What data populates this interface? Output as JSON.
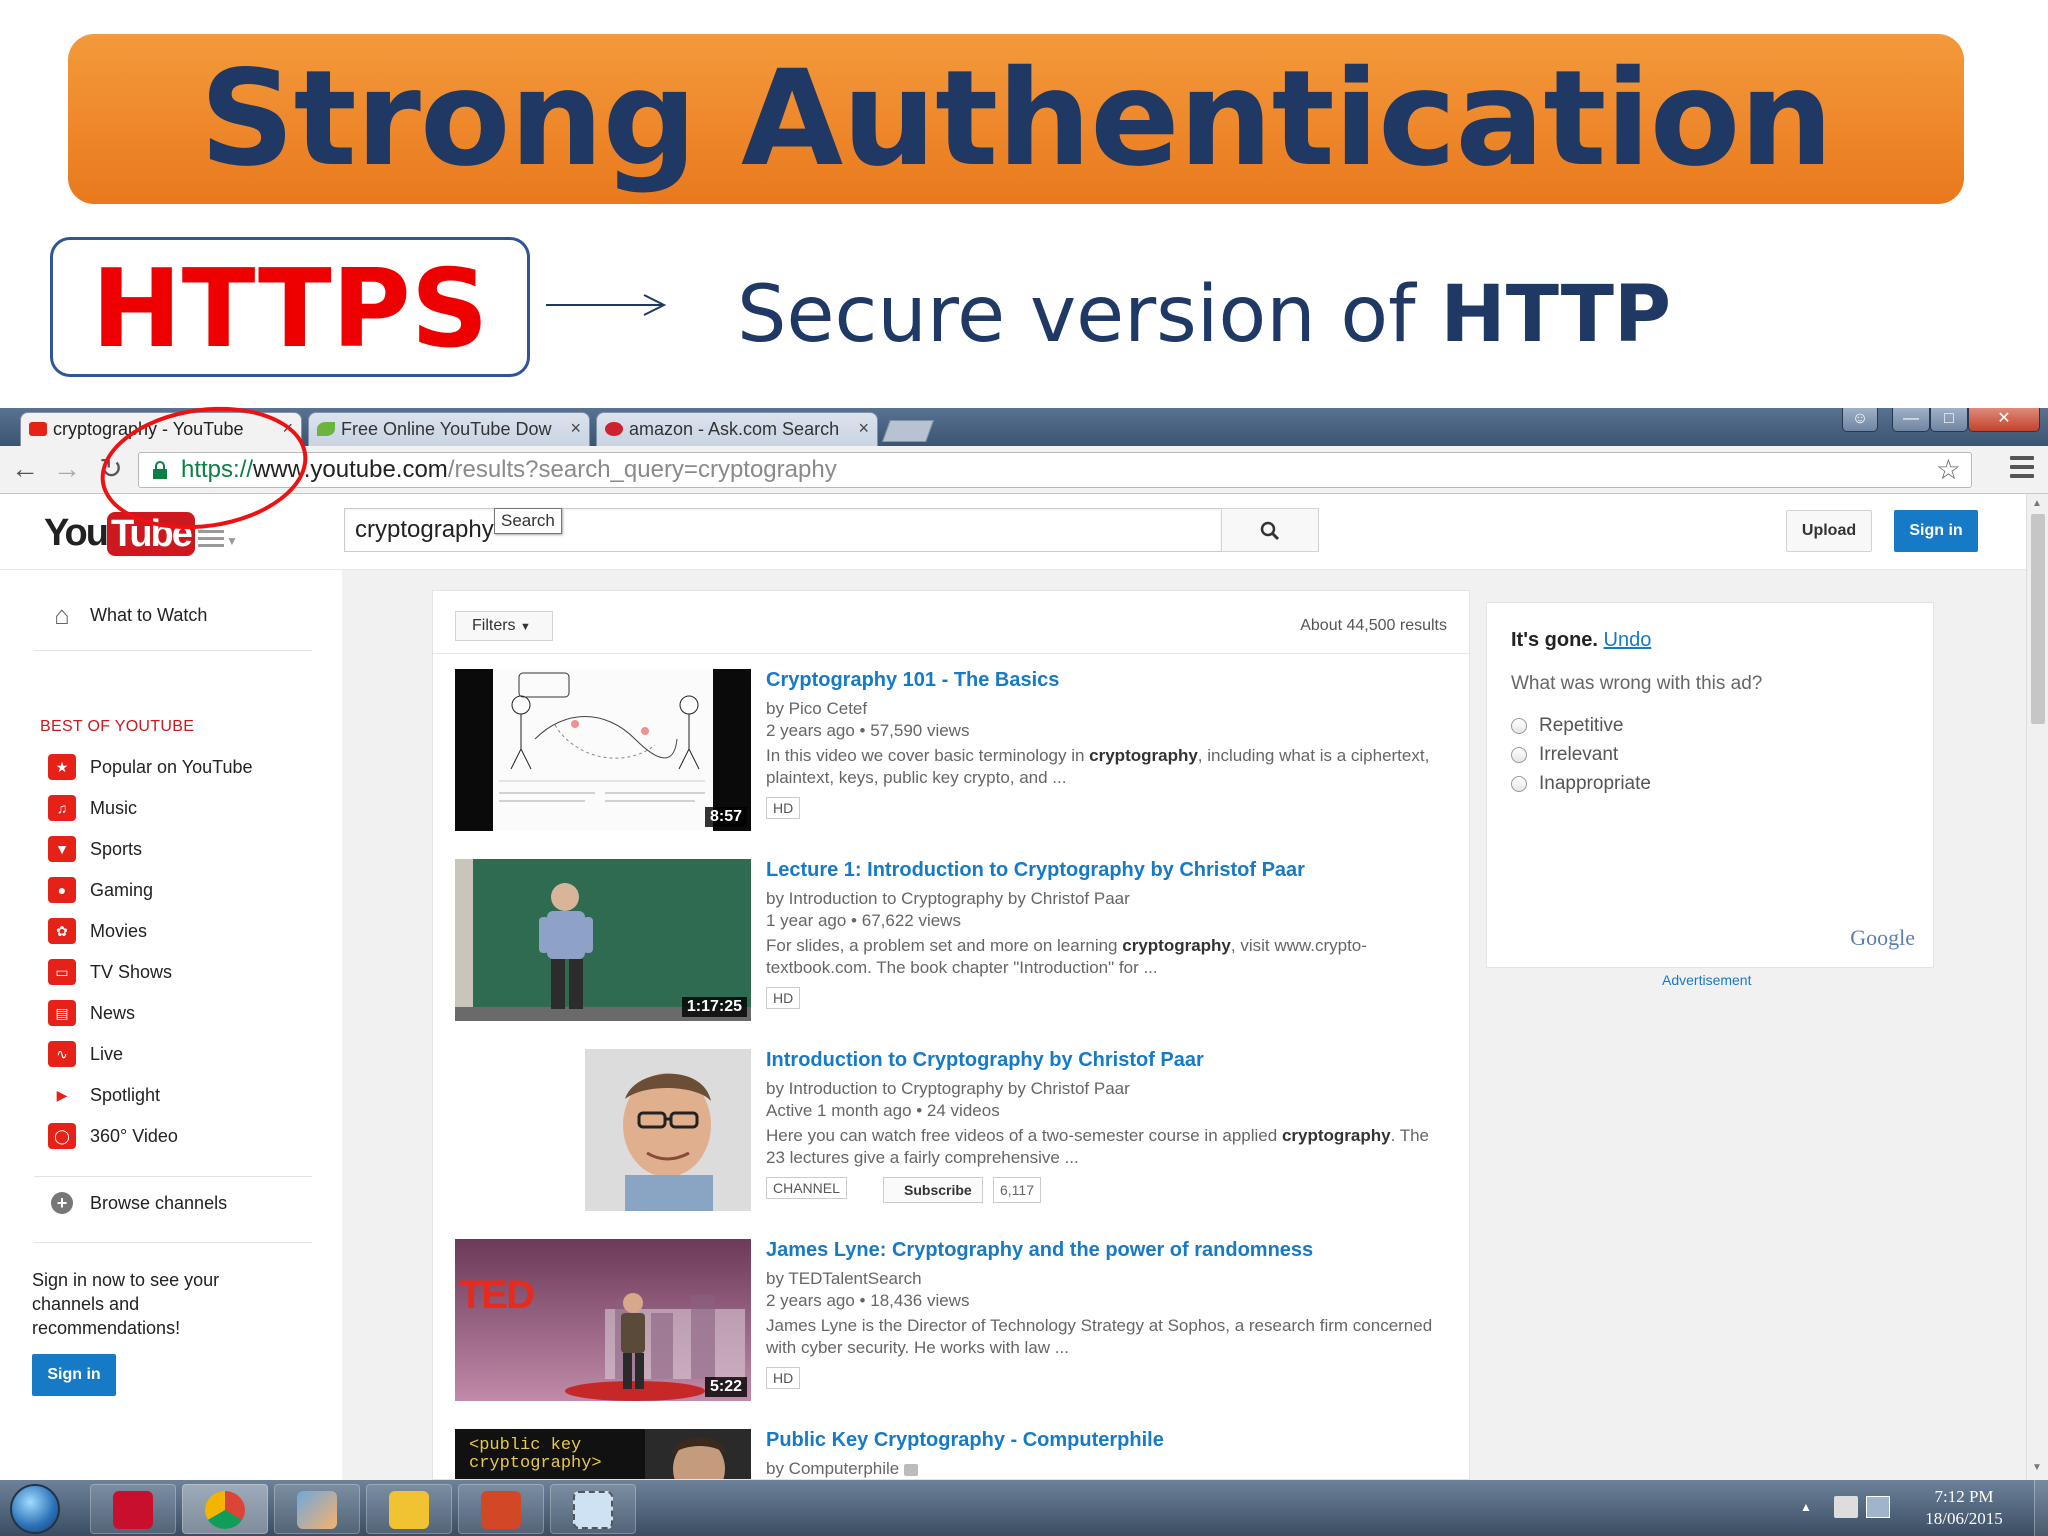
{
  "slide": {
    "title": "Strong Authentication",
    "https_label": "HTTPS",
    "secure_prefix": "Secure version of ",
    "secure_bold": "HTTP"
  },
  "browser": {
    "tabs": [
      {
        "label": "cryptography - YouTube",
        "icon": "youtube-icon",
        "active": true
      },
      {
        "label": "Free Online YouTube Dow",
        "icon": "leaf-icon",
        "active": false
      },
      {
        "label": "amazon - Ask.com Search",
        "icon": "ask-icon",
        "active": false
      }
    ],
    "url": {
      "scheme": "https://",
      "host": "www.youtube.com",
      "path": "/results?search_query=cryptography"
    },
    "colors": {
      "scheme": "#0b8043",
      "annotation_circle": "#ee1111"
    }
  },
  "youtube": {
    "logo_you": "You",
    "logo_tube": "Tube",
    "search": {
      "value": "cryptography",
      "tooltip": "Search"
    },
    "upload_label": "Upload",
    "signin_label": "Sign in",
    "guide": {
      "what_to_watch": "What to Watch",
      "section_header": "BEST OF YOUTUBE",
      "items": [
        {
          "label": "Popular on YouTube",
          "icon": "star-icon"
        },
        {
          "label": "Music",
          "icon": "headphones-icon"
        },
        {
          "label": "Sports",
          "icon": "trophy-icon"
        },
        {
          "label": "Gaming",
          "icon": "gamepad-icon"
        },
        {
          "label": "Movies",
          "icon": "film-icon"
        },
        {
          "label": "TV Shows",
          "icon": "tv-icon"
        },
        {
          "label": "News",
          "icon": "newspaper-icon"
        },
        {
          "label": "Live",
          "icon": "live-icon"
        },
        {
          "label": "Spotlight",
          "icon": "spotlight-icon"
        },
        {
          "label": "360° Video",
          "icon": "360-icon"
        }
      ],
      "browse_channels": "Browse channels",
      "promo": "Sign in now to see your channels and recommendations!",
      "signin_label": "Sign in"
    },
    "results": {
      "filters_label": "Filters",
      "count": "About 44,500 results",
      "items": [
        {
          "title": "Cryptography 101 - The Basics",
          "by": "by Pico Cetef",
          "meta": "2 years ago  •  57,590 views",
          "desc_pre": "In this video we cover basic terminology in ",
          "desc_bold": "cryptography",
          "desc_post": ", including what is a ciphertext, plaintext, keys, public key crypto, and ...",
          "duration": "8:57",
          "badge": "HD"
        },
        {
          "title": "Lecture 1: Introduction to Cryptography by Christof Paar",
          "by": "by Introduction to Cryptography by Christof Paar",
          "meta": "1 year ago  •  67,622 views",
          "desc_pre": "For slides, a problem set and more on learning ",
          "desc_bold": "cryptography",
          "desc_post": ", visit www.crypto-textbook.com. The book chapter \"Introduction\" for ...",
          "duration": "1:17:25",
          "badge": "HD"
        },
        {
          "title": "Introduction to Cryptography by Christof Paar",
          "by": "by Introduction to Cryptography by Christof Paar",
          "meta": "Active 1 month ago  •  24 videos",
          "desc_pre": "Here you can watch free videos of a two-semester course in applied ",
          "desc_bold": "cryptography",
          "desc_post": ". The 23 lectures give a fairly comprehensive ...",
          "badge": "CHANNEL",
          "subscribe_label": "Subscribe",
          "subscribers": "6,117"
        },
        {
          "title": "James Lyne: Cryptography and the power of randomness",
          "by": "by TEDTalentSearch",
          "meta": "2 years ago  •  18,436 views",
          "desc_pre": "James Lyne is the Director of Technology Strategy at Sophos, a research firm concerned with cyber security. He works with law ...",
          "desc_bold": "",
          "desc_post": "",
          "duration": "5:22",
          "badge": "HD",
          "thumb_text": "TED"
        },
        {
          "title": "Public Key Cryptography - Computerphile",
          "by": "by Computerphile",
          "thumb_text": "<public key\ncryptography>"
        }
      ]
    },
    "ad": {
      "gone_prefix": "It's gone.",
      "undo": "Undo",
      "question": "What was wrong with this ad?",
      "options": [
        "Repetitive",
        "Irrelevant",
        "Inappropriate"
      ],
      "brand": "Google",
      "label": "Advertisement"
    }
  },
  "taskbar": {
    "apps": [
      "pdf-reader-icon",
      "chrome-icon",
      "paint-icon",
      "file-explorer-icon",
      "powerpoint-icon",
      "snipping-tool-icon"
    ],
    "time": "7:12 PM",
    "date": "18/06/2015"
  }
}
